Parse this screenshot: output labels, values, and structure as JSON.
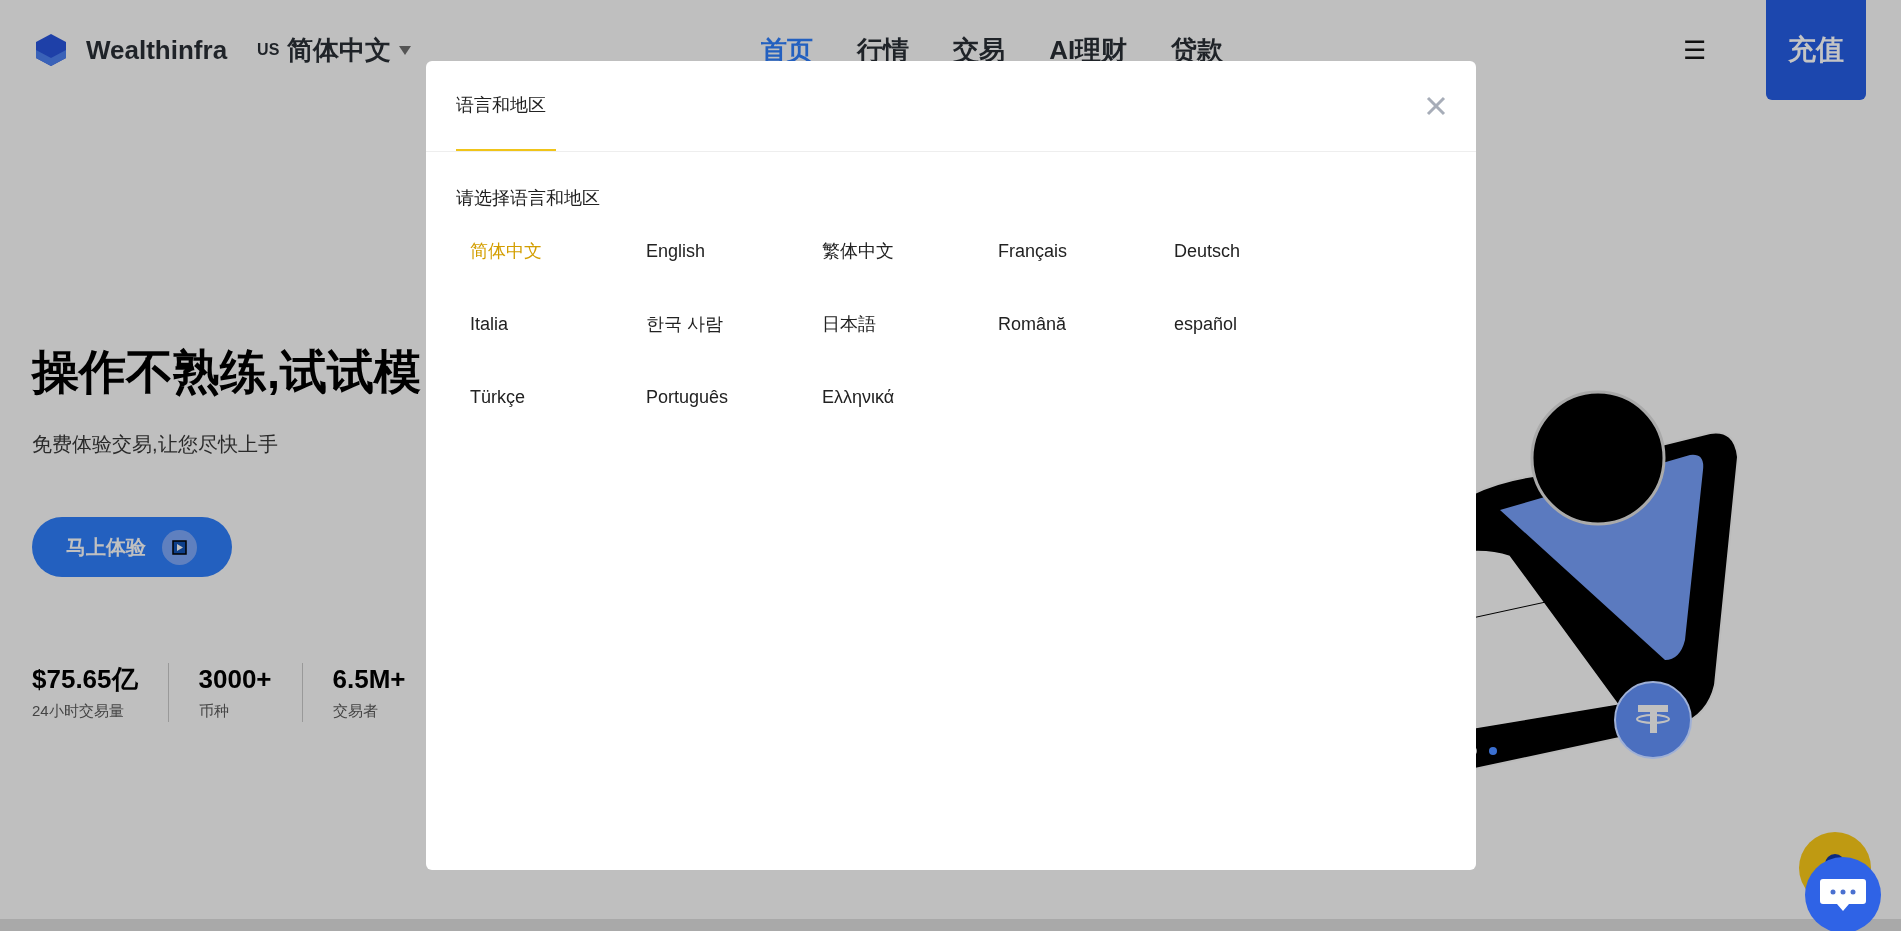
{
  "header": {
    "logo": "Wealthinfra",
    "region": "US",
    "language": "简体中文",
    "nav": [
      {
        "label": "首页",
        "selected": true
      },
      {
        "label": "行情",
        "selected": false
      },
      {
        "label": "交易",
        "selected": false
      },
      {
        "label": "AI理财",
        "selected": false
      },
      {
        "label": "贷款",
        "selected": false
      }
    ],
    "menu": "☰",
    "cta": "充值"
  },
  "hero": {
    "title": "操作不熟练,试试模",
    "subtitle": "免费体验交易,让您尽快上手",
    "button": "马上体验",
    "stats": [
      {
        "value": "$75.65亿",
        "label": "24小时交易量"
      },
      {
        "value": "3000+",
        "label": "币种"
      },
      {
        "value": "6.5M+",
        "label": "交易者"
      }
    ]
  },
  "dialog": {
    "tabs": [
      {
        "label": "语言和地区",
        "selected": true
      }
    ],
    "prompt": "请选择语言和地区",
    "languages": [
      {
        "label": "简体中文",
        "selected": true
      },
      {
        "label": "English",
        "selected": false
      },
      {
        "label": "繁体中文",
        "selected": false
      },
      {
        "label": "Français",
        "selected": false
      },
      {
        "label": "Deutsch",
        "selected": false
      },
      {
        "label": "Italia",
        "selected": false
      },
      {
        "label": "한국 사람",
        "selected": false
      },
      {
        "label": "日本語",
        "selected": false
      },
      {
        "label": "Română",
        "selected": false
      },
      {
        "label": "español",
        "selected": false
      },
      {
        "label": "Türkçe",
        "selected": false
      },
      {
        "label": "Português",
        "selected": false
      },
      {
        "label": "Ελληνικά",
        "selected": false
      }
    ]
  }
}
